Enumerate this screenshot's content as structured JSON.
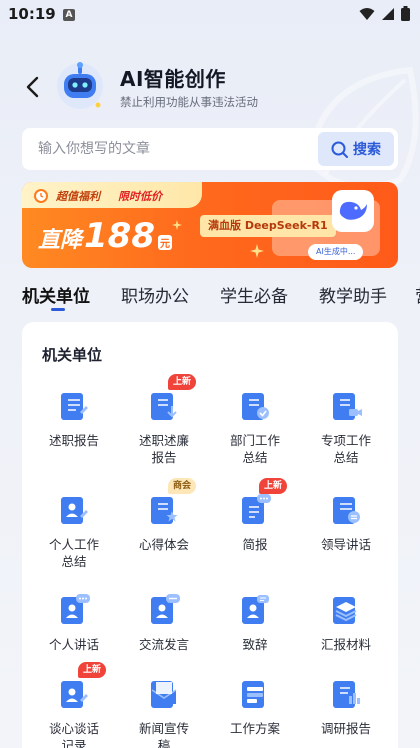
{
  "status": {
    "time": "10:19",
    "notif": "A"
  },
  "header": {
    "title": "AI智能创作",
    "subtitle": "禁止利用功能从事违法活动"
  },
  "search": {
    "placeholder": "输入你想写的文章",
    "button": "搜索"
  },
  "banner": {
    "tag1": "超值福利",
    "tag2": "限时低价",
    "price_prefix": "直降",
    "price": "188",
    "price_unit": "元",
    "pill": "满血版 DeepSeek-R1",
    "generating": "AI生成中..."
  },
  "tabs": [
    "机关单位",
    "职场办公",
    "学生必备",
    "教学助手",
    "营"
  ],
  "section": {
    "title": "机关单位",
    "items": [
      {
        "label": "述职报告",
        "badge": "",
        "icon": "report-icon"
      },
      {
        "label": "述职述廉报告",
        "badge": "上新",
        "icon": "download-doc-icon"
      },
      {
        "label": "部门工作总结",
        "badge": "",
        "icon": "check-doc-icon"
      },
      {
        "label": "专项工作总结",
        "badge": "",
        "icon": "video-doc-icon"
      },
      {
        "label": "个人工作总结",
        "badge": "",
        "icon": "person-edit-icon"
      },
      {
        "label": "心得体会",
        "badge": "商会",
        "icon": "star-doc-icon"
      },
      {
        "label": "简报",
        "badge": "上新",
        "icon": "chat-doc-icon"
      },
      {
        "label": "领导讲话",
        "badge": "",
        "icon": "list-doc-icon"
      },
      {
        "label": "个人讲话",
        "badge": "",
        "icon": "person-speech-icon"
      },
      {
        "label": "交流发言",
        "badge": "",
        "icon": "exchange-icon"
      },
      {
        "label": "致辞",
        "badge": "",
        "icon": "speech-icon"
      },
      {
        "label": "汇报材料",
        "badge": "",
        "icon": "layers-icon"
      },
      {
        "label": "谈心谈话记录",
        "badge": "上新",
        "icon": "talk-record-icon"
      },
      {
        "label": "新闻宣传稿",
        "badge": "",
        "icon": "mail-icon"
      },
      {
        "label": "工作方案",
        "badge": "",
        "icon": "plan-icon"
      },
      {
        "label": "调研报告",
        "badge": "",
        "icon": "research-icon"
      }
    ]
  },
  "colors": {
    "accent": "#2b5bd8",
    "banner": "#ff6a1d",
    "badge_red": "#f0433a"
  }
}
